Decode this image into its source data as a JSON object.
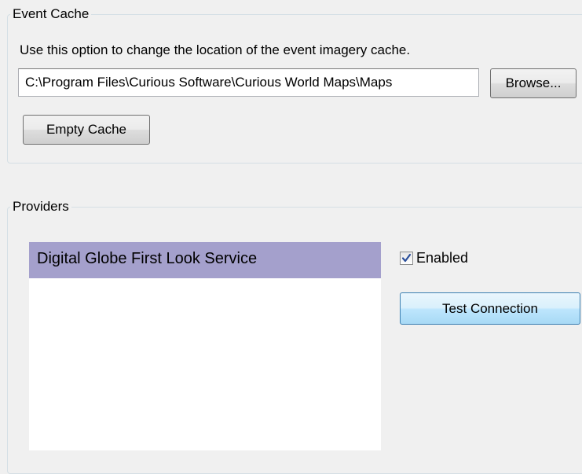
{
  "event_cache": {
    "title": "Event Cache",
    "description": "Use this option to change the location of the event imagery cache.",
    "path_value": "C:\\Program Files\\Curious Software\\Curious World Maps\\Maps",
    "browse_label": "Browse...",
    "empty_cache_label": "Empty Cache"
  },
  "providers": {
    "title": "Providers",
    "items": [
      {
        "label": "Digital Globe First Look Service",
        "selected": true
      }
    ],
    "enabled_label": "Enabled",
    "enabled_checked": true,
    "test_connection_label": "Test Connection"
  },
  "colors": {
    "selection": "#a4a0cc",
    "checkmark": "#2a4e9a"
  },
  "icons": {
    "checkbox": "checkmark-icon"
  }
}
